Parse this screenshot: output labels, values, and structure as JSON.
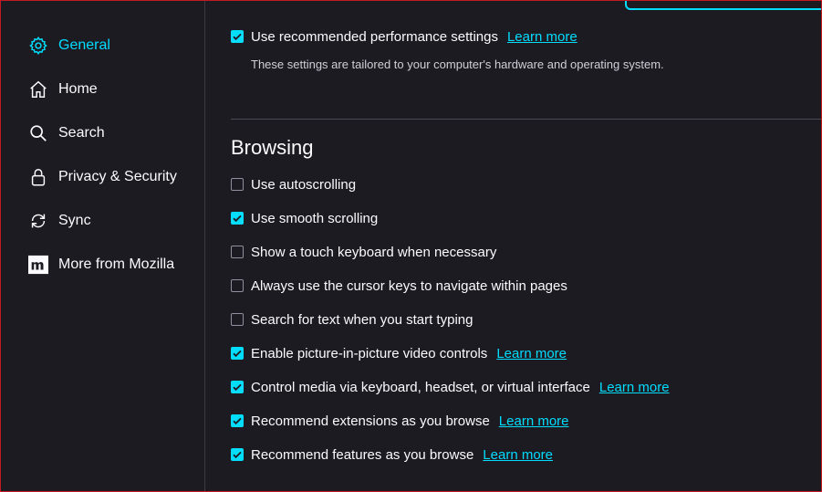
{
  "sidebar": {
    "items": [
      {
        "label": "General",
        "icon": "gear-icon",
        "selected": true
      },
      {
        "label": "Home",
        "icon": "home-icon",
        "selected": false
      },
      {
        "label": "Search",
        "icon": "search-icon",
        "selected": false
      },
      {
        "label": "Privacy & Security",
        "icon": "lock-icon",
        "selected": false
      },
      {
        "label": "Sync",
        "icon": "sync-icon",
        "selected": false
      },
      {
        "label": "More from Mozilla",
        "icon": "mozilla-m-icon",
        "selected": false
      }
    ]
  },
  "performance": {
    "label": "Use recommended performance settings",
    "checked": true,
    "link": "Learn more",
    "description": "These settings are tailored to your computer's hardware and operating system."
  },
  "browsing": {
    "heading": "Browsing",
    "options": [
      {
        "label": "Use autoscrolling",
        "checked": false
      },
      {
        "label": "Use smooth scrolling",
        "checked": true
      },
      {
        "label": "Show a touch keyboard when necessary",
        "checked": false
      },
      {
        "label": "Always use the cursor keys to navigate within pages",
        "checked": false
      },
      {
        "label": "Search for text when you start typing",
        "checked": false
      },
      {
        "label": "Enable picture-in-picture video controls",
        "checked": true,
        "link": "Learn more"
      },
      {
        "label": "Control media via keyboard, headset, or virtual interface",
        "checked": true,
        "link": "Learn more"
      },
      {
        "label": "Recommend extensions as you browse",
        "checked": true,
        "link": "Learn more"
      },
      {
        "label": "Recommend features as you browse",
        "checked": true,
        "link": "Learn more"
      }
    ]
  },
  "colors": {
    "accent": "#00ddff",
    "background": "#1c1b22",
    "text": "#fbfbfe"
  }
}
